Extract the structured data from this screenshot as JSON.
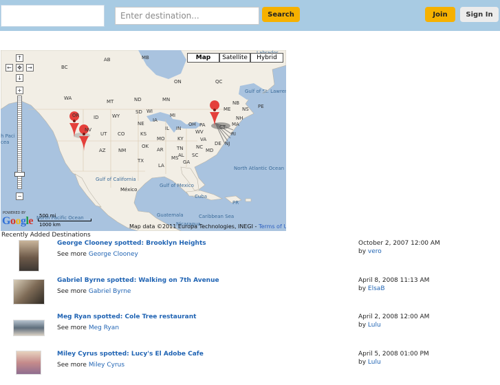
{
  "header": {
    "search_placeholder": "Enter destination...",
    "search_label": "Search",
    "join_label": "Join",
    "signin_label": "Sign In"
  },
  "map": {
    "types": [
      "Map",
      "Satellite",
      "Hybrid"
    ],
    "selected_type": "Map",
    "nav_controls": {
      "up": "↑",
      "left": "←",
      "center": "✥",
      "right": "→",
      "down": "↓",
      "zoom_in": "+",
      "zoom_out": "−"
    },
    "labels": {
      "regions": [
        "BC",
        "AB",
        "MB",
        "ON",
        "QC",
        "WA",
        "MT",
        "ND",
        "MN",
        "OR",
        "ID",
        "WY",
        "SD",
        "WI",
        "MI",
        "NV",
        "UT",
        "NE",
        "IA",
        "IL",
        "IN",
        "OH",
        "PA",
        "CO",
        "KS",
        "MO",
        "KY",
        "WV",
        "VA",
        "AZ",
        "NM",
        "OK",
        "AR",
        "TN",
        "NC",
        "TX",
        "LA",
        "MS",
        "AL",
        "GA",
        "SC",
        "NB",
        "PE",
        "NS",
        "ME",
        "NH",
        "MA",
        "RI",
        "CT",
        "NJ",
        "DE",
        "MD"
      ],
      "places": [
        "Labrador",
        "Gulf of St. Lawrence",
        "México",
        "Gulf of California",
        "Gulf of Mexico",
        "Cuba",
        "Guatemala",
        "Caribbean Sea",
        "Nicaragua",
        "PR",
        "North Atlantic Ocean",
        "North Pacific Ocean"
      ],
      "partial_labels": [
        "h Paci",
        "cea"
      ]
    },
    "attribution": "Map data ©2011 Europa Technologies, INEGI - ",
    "terms": "Terms of Use",
    "powered_by": "POWERED BY",
    "google_letters": [
      "G",
      "o",
      "o",
      "g",
      "l",
      "e"
    ],
    "scale_mi": "500 mi",
    "scale_km": "1000 km"
  },
  "recent": {
    "title": "Recently Added Destinations",
    "see_more": "See more",
    "by": "by",
    "entries": [
      {
        "title": "George Clooney spotted: Brooklyn Heights",
        "celebrity": "George Clooney",
        "date": "October 2, 2007 12:00 AM",
        "user": "vero"
      },
      {
        "title": "Gabriel Byrne spotted: Walking on 7th Avenue",
        "celebrity": "Gabriel Byrne",
        "date": "April 8, 2008 11:13 AM",
        "user": "ElsaB"
      },
      {
        "title": "Meg Ryan spotted: Cole Tree restaurant",
        "celebrity": "Meg Ryan",
        "date": "April 2, 2008 12:00 AM",
        "user": "Lulu"
      },
      {
        "title": "Miley Cyrus spotted: Lucy's El Adobe Cafe",
        "celebrity": "Miley Cyrus",
        "date": "April 5, 2008 01:00 PM",
        "user": "Lulu"
      }
    ]
  },
  "colors": {
    "header_bg": "#a8cbe3",
    "accent": "#f6b100",
    "link": "#1f63b3",
    "water": "#a9c3df",
    "land": "#f2eee5",
    "marker": "#e4403b"
  }
}
